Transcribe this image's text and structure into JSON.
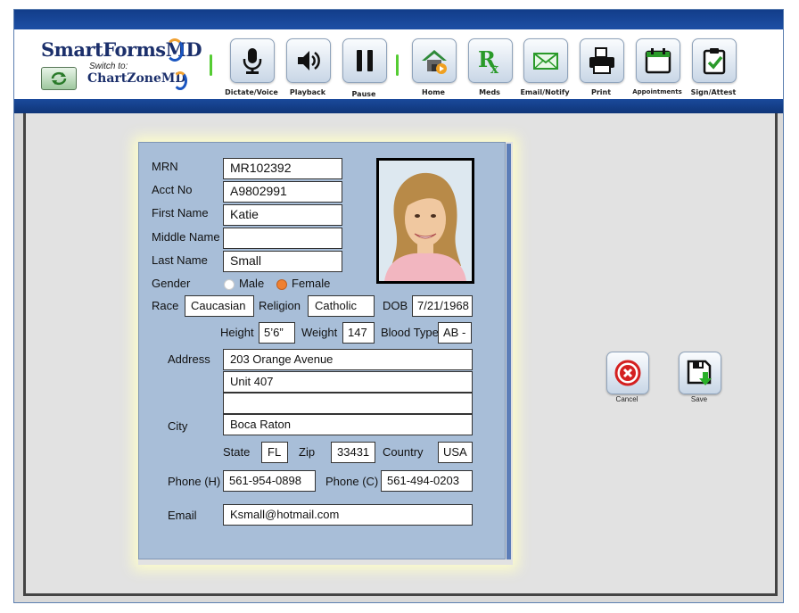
{
  "brand": {
    "app_name": "SmartFormsMD",
    "switch_to": "Switch to:",
    "alt_app_name": "ChartZoneMD"
  },
  "toolbar": {
    "dictate": "Dictate/Voice",
    "playback": "Playback",
    "pause": "Pause",
    "home": "Home",
    "meds": "Meds",
    "email": "Email/Notify",
    "print": "Print",
    "appointments": "Appointments",
    "sign": "Sign/Attest"
  },
  "form": {
    "labels": {
      "mrn": "MRN",
      "acct": "Acct No",
      "first": "First Name",
      "middle": "Middle Name",
      "last": "Last Name",
      "gender": "Gender",
      "male": "Male",
      "female": "Female",
      "race": "Race",
      "religion": "Religion",
      "dob": "DOB",
      "height": "Height",
      "weight": "Weight",
      "blood": "Blood Type",
      "address": "Address",
      "city": "City",
      "state": "State",
      "zip": "Zip",
      "country": "Country",
      "phone_h": "Phone (H)",
      "phone_c": "Phone (C)",
      "email": "Email"
    },
    "values": {
      "mrn": "MR102392",
      "acct": "A9802991",
      "first": "Katie",
      "middle": "",
      "last": "Small",
      "gender": "Female",
      "race": "Caucasian",
      "religion": "Catholic",
      "dob": "7/21/1968",
      "height": "5’6”",
      "weight": "147",
      "blood": "AB -",
      "address1": "203 Orange Avenue",
      "address2": "Unit 407",
      "address3": "",
      "city": "Boca Raton",
      "state": "FL",
      "zip": "33431",
      "country": "USA",
      "phone_h": "561-954-0898",
      "phone_c": "561-494-0203",
      "email": "Ksmall@hotmail.com"
    }
  },
  "actions": {
    "cancel": "Cancel",
    "save": "Save"
  },
  "colors": {
    "header_blue": "#1d4fa5",
    "form_bg": "#a8bed8",
    "gender_selected": "#f08030"
  }
}
